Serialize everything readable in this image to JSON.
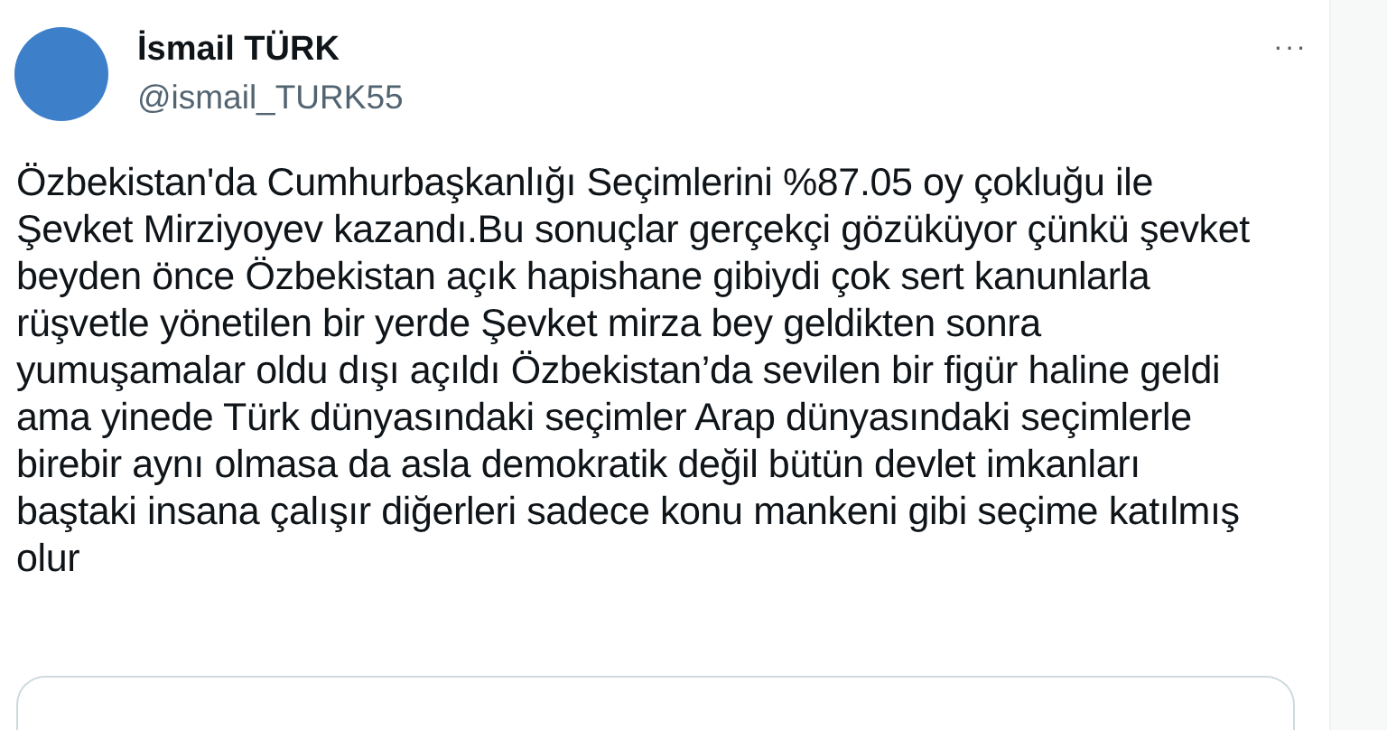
{
  "author": {
    "name": "İsmail TÜRK",
    "handle": "@ismail_TURK55"
  },
  "more_button": "···",
  "text": "Özbekistan'da Cumhurbaşkanlığı Seçimlerini %87.05 oy çokluğu ile\nŞevket Mirziyoyev kazandı.Bu sonuçlar gerçekçi gözüküyor çünkü şevket\nbeyden önce Özbekistan açık hapishane gibiydi çok sert kanunlarla\nrüşvetle yönetilen bir yerde Şevket mirza bey geldikten sonra\nyumuşamalar oldu dışı açıldı Özbekistan’da sevilen bir figür haline geldi\nama yinede Türk dünyasındaki seçimler Arap dünyasındaki seçimlerle\nbirebir aynı olmasa da asla demokratik değil bütün devlet imkanları\nbaştaki insana çalışır diğerleri sadece konu mankeni gibi seçime katılmış\nolur"
}
